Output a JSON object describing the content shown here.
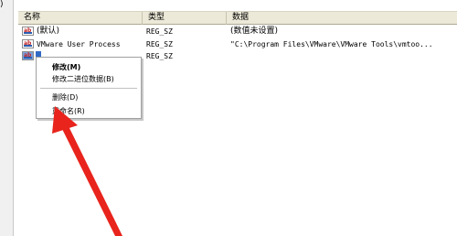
{
  "edge_char": ")",
  "columns": {
    "name": "名称",
    "type": "类型",
    "data": "数据"
  },
  "rows": [
    {
      "icon": "string-value-icon",
      "name": "(默认)",
      "type": "REG_SZ",
      "data": "(数值未设置)"
    },
    {
      "icon": "string-value-icon",
      "name": "VMware User Process",
      "type": "REG_SZ",
      "data": "\"C:\\Program Files\\VMware\\VMware Tools\\vmtoo..."
    },
    {
      "icon": "string-value-icon",
      "name": "",
      "type": "REG_SZ",
      "data": ""
    }
  ],
  "context_menu": {
    "modify": "修改(M)",
    "modify_binary": "修改二进位数据(B)",
    "delete": "删除(D)",
    "rename": "重命名(R)"
  },
  "colors": {
    "header_bg": "#ece9d8",
    "selection": "#316ac5",
    "arrow": "#e8241c"
  },
  "icon_label": "ab"
}
